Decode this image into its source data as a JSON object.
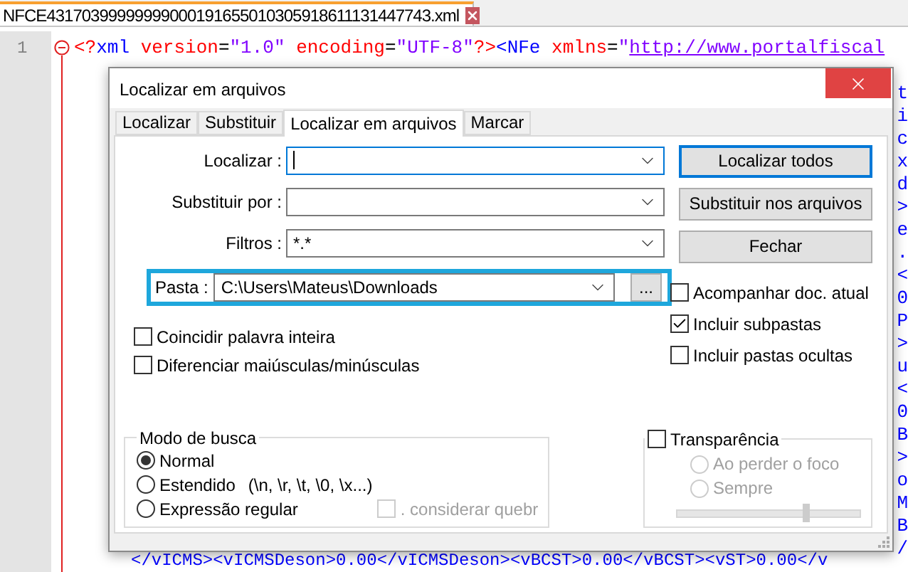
{
  "editor": {
    "file_tab": {
      "title": "NFCE43170399999999000191655010305918611131447743.xml",
      "active": true
    },
    "line_number": "1",
    "line_1": [
      {
        "kind": "tag",
        "text": "<?"
      },
      {
        "kind": "element",
        "text": "xml"
      },
      {
        "kind": "attr",
        "text": " version"
      },
      {
        "kind": "op",
        "text": "="
      },
      {
        "kind": "value",
        "text": "\"1.0\""
      },
      {
        "kind": "attr",
        "text": " encoding"
      },
      {
        "kind": "op",
        "text": "="
      },
      {
        "kind": "value",
        "text": "\"UTF-8\""
      },
      {
        "kind": "tag",
        "text": "?>"
      },
      {
        "kind": "element",
        "text": "<NFe"
      },
      {
        "kind": "attr",
        "text": " xmlns"
      },
      {
        "kind": "op",
        "text": "="
      },
      {
        "kind": "value",
        "text": "\""
      },
      {
        "kind": "link",
        "text": "http://www.portalfiscal"
      }
    ],
    "wrapped_line_ends": [
      "t",
      "i",
      "c",
      "x",
      "d",
      ">",
      "e",
      ".",
      "<",
      "0",
      "P",
      ">",
      "u",
      "<",
      "0",
      "B",
      ">",
      "o",
      "M",
      "B",
      "/"
    ],
    "last_line": "</vICMS><vICMSDeson>0.00</vICMSDeson><vBCST>0.00</vBCST><vST>0.00</v"
  },
  "dialog": {
    "title": "Localizar em arquivos",
    "tabs": [
      {
        "label": "Localizar",
        "selected": false
      },
      {
        "label": "Substituir",
        "selected": false
      },
      {
        "label": "Localizar em arquivos",
        "selected": true
      },
      {
        "label": "Marcar",
        "selected": false
      }
    ],
    "fields": [
      {
        "label": "Localizar :",
        "focused": true
      },
      {
        "label": "Substituir por :",
        "focused": false
      },
      {
        "label": "Filtros :",
        "value": "*.*",
        "focused": false
      }
    ],
    "folder": {
      "label": "Pasta :",
      "value": "C:\\Users\\Mateus\\Downloads",
      "highlighted": true,
      "browse": "..."
    },
    "buttons": [
      {
        "label": "Localizar todos",
        "default": true
      },
      {
        "label": "Substituir nos arquivos",
        "default": false
      },
      {
        "label": "Fechar",
        "default": false
      }
    ],
    "folder_options": [
      {
        "label": "Acompanhar doc. atual",
        "checked": false
      },
      {
        "label": "Incluir subpastas",
        "checked": true
      },
      {
        "label": "Incluir pastas ocultas",
        "checked": false
      }
    ],
    "match_options": [
      {
        "label": "Coincidir palavra inteira",
        "checked": false
      },
      {
        "label": "Diferenciar maiúsculas/minúsculas",
        "checked": false
      }
    ],
    "search_mode": {
      "title": "Modo de busca",
      "options": [
        {
          "label": "Normal",
          "selected": true
        },
        {
          "label": "Estendido",
          "hint": "(\\n, \\r, \\t, \\0, \\x...)",
          "selected": false
        },
        {
          "label": "Expressão regular",
          "selected": false
        }
      ],
      "dot_option": {
        "label": ". considerar quebr",
        "checked": false,
        "disabled": true
      }
    },
    "transparency": {
      "label": "Transparência",
      "checked": false,
      "disabled": true,
      "level": 0.7,
      "options": [
        {
          "label": "Ao perder o foco",
          "selected": false
        },
        {
          "label": "Sempre",
          "selected": false
        }
      ]
    }
  }
}
